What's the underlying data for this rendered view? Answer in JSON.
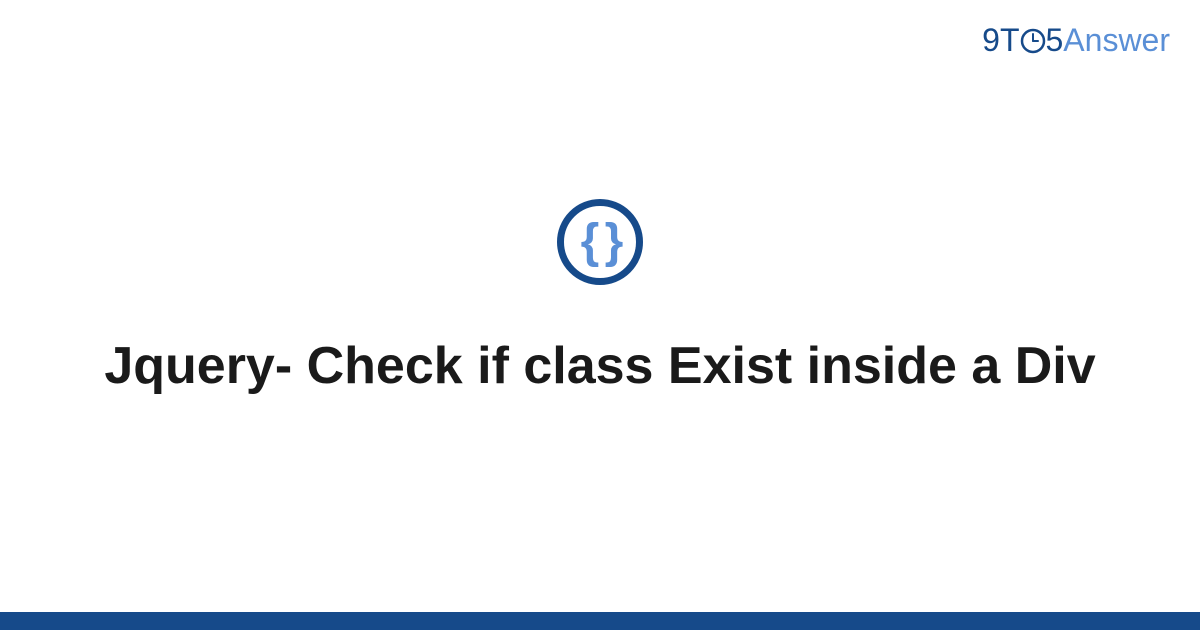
{
  "brand": {
    "part1": "9T",
    "part2": "5",
    "part3": "Answer"
  },
  "icon": {
    "symbol": "{ }"
  },
  "title": "Jquery- Check if class Exist inside a Div",
  "colors": {
    "primary": "#164a8a",
    "secondary": "#5a8fd6"
  }
}
